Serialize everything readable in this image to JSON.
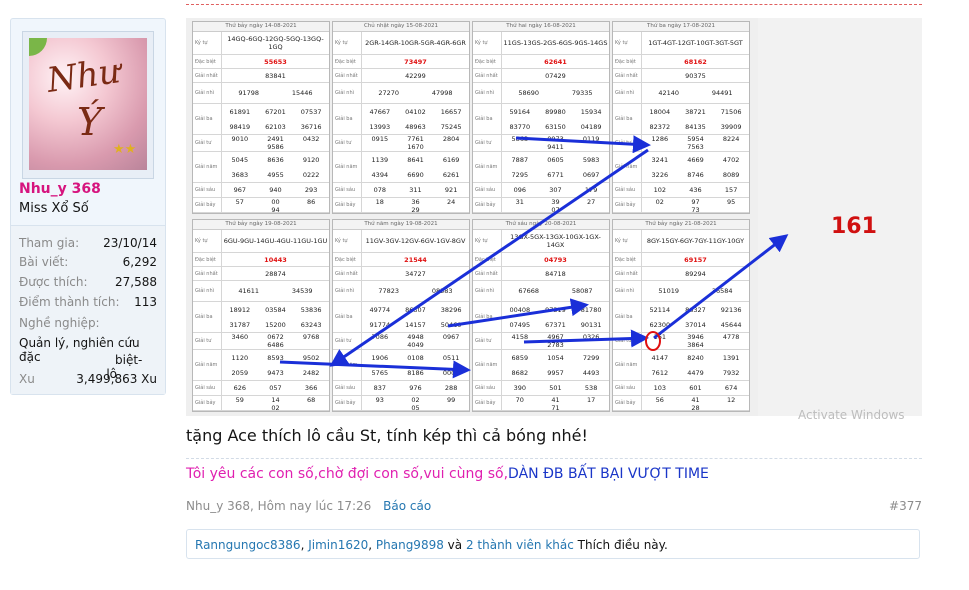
{
  "user": {
    "name": "Nhu_y 368",
    "title": "Miss Xổ Số",
    "avatar_text_1": "Như",
    "avatar_text_2": "Ý",
    "stats": [
      {
        "label": "Tham gia:",
        "value": "23/10/14"
      },
      {
        "label": "Bài viết:",
        "value": "6,292"
      },
      {
        "label": "Được thích:",
        "value": "27,588"
      },
      {
        "label": "Điểm thành tích:",
        "value": "113"
      },
      {
        "label": "Nghề nghiệp:",
        "value": ""
      },
      {
        "label": "Quản lý, nghiên cứu đặc",
        "value": ""
      },
      {
        "label": "biệt- lô",
        "value": ""
      },
      {
        "label": "Xu",
        "value": "3,499,863 Xu"
      }
    ]
  },
  "image": {
    "highlight_number": "161",
    "watermark": "Activate Windows",
    "row_labels": [
      "Ký tự",
      "Đặc biệt",
      "Giải nhất",
      "Giải nhì",
      "Giải ba",
      "Giải tư",
      "Giải năm",
      "Giải sáu",
      "Giải bảy"
    ],
    "tables": [
      {
        "date": "Thứ bảy ngày 14-08-2021",
        "kytu": "14GQ-6GQ-12GQ-5GQ-13GQ-1GQ",
        "db": "55653",
        "g1": "83841",
        "g2": [
          "91798",
          "15446"
        ],
        "g3": [
          "61891",
          "67201",
          "07537",
          "98419",
          "62103",
          "36716"
        ],
        "g4": [
          "9010",
          "2491",
          "0432",
          "9586"
        ],
        "g5": [
          "5045",
          "8636",
          "9120",
          "3683",
          "4955",
          "0222"
        ],
        "g6": [
          "967",
          "940",
          "293"
        ],
        "g7": [
          "57",
          "00",
          "86",
          "94"
        ]
      },
      {
        "date": "Chủ nhật ngày 15-08-2021",
        "kytu": "2GR-14GR-10GR-5GR-4GR-6GR",
        "db": "73497",
        "g1": "42299",
        "g2": [
          "27270",
          "47998"
        ],
        "g3": [
          "47667",
          "04102",
          "16657",
          "13993",
          "48963",
          "75245"
        ],
        "g4": [
          "0915",
          "7761",
          "2804",
          "1670"
        ],
        "g5": [
          "1139",
          "8641",
          "6169",
          "4394",
          "6690",
          "6261"
        ],
        "g6": [
          "078",
          "311",
          "921"
        ],
        "g7": [
          "18",
          "36",
          "24",
          "29"
        ]
      },
      {
        "date": "Thứ hai ngày 16-08-2021",
        "kytu": "11GS-13GS-2GS-6GS-9GS-14GS",
        "db": "62641",
        "g1": "07429",
        "g2": [
          "58690",
          "79335"
        ],
        "g3": [
          "59164",
          "89980",
          "15934",
          "83770",
          "63150",
          "04189"
        ],
        "g4": [
          "5863",
          "0973",
          "0119",
          "9411"
        ],
        "g5": [
          "7887",
          "0605",
          "5983",
          "7295",
          "6771",
          "0697"
        ],
        "g6": [
          "096",
          "307",
          "179"
        ],
        "g7": [
          "31",
          "39",
          "27",
          "07"
        ]
      },
      {
        "date": "Thứ ba ngày 17-08-2021",
        "kytu": "1GT-4GT-12GT-10GT-3GT-5GT",
        "db": "68162",
        "g1": "90375",
        "g2": [
          "42140",
          "94491"
        ],
        "g3": [
          "18004",
          "38721",
          "71506",
          "82372",
          "84135",
          "39909"
        ],
        "g4": [
          "1286",
          "5954",
          "8224",
          "7563"
        ],
        "g5": [
          "3241",
          "4669",
          "4702",
          "3226",
          "8746",
          "8089"
        ],
        "g6": [
          "102",
          "436",
          "157"
        ],
        "g7": [
          "02",
          "97",
          "95",
          "73"
        ]
      },
      {
        "date": "Thứ bảy ngày 19-08-2021",
        "kytu": "6GU-9GU-14GU-4GU-11GU-1GU",
        "db": "10443",
        "g1": "28874",
        "g2": [
          "41611",
          "34539"
        ],
        "g3": [
          "18912",
          "03584",
          "53836",
          "31787",
          "15200",
          "63243"
        ],
        "g4": [
          "3460",
          "0672",
          "9768",
          "6486"
        ],
        "g5": [
          "1120",
          "8593",
          "9502",
          "2059",
          "9473",
          "2482"
        ],
        "g6": [
          "626",
          "057",
          "366"
        ],
        "g7": [
          "59",
          "14",
          "68",
          "02"
        ]
      },
      {
        "date": "Thứ năm ngày 19-08-2021",
        "kytu": "11GV-3GV-12GV-6GV-1GV-8GV",
        "db": "21544",
        "g1": "34727",
        "g2": [
          "77823",
          "08383"
        ],
        "g3": [
          "49774",
          "86307",
          "38296",
          "91774",
          "14157",
          "50469"
        ],
        "g4": [
          "7086",
          "4948",
          "0967",
          "4049"
        ],
        "g5": [
          "1906",
          "0108",
          "0511",
          "5765",
          "8186",
          "0004"
        ],
        "g6": [
          "837",
          "976",
          "288"
        ],
        "g7": [
          "93",
          "02",
          "99",
          "05"
        ]
      },
      {
        "date": "Thứ sáu ngày 20-08-2021",
        "kytu": "13GX-5GX-13GX-10GX-1GX-14GX",
        "db": "04793",
        "g1": "84718",
        "g2": [
          "67668",
          "58087"
        ],
        "g3": [
          "00408",
          "97319",
          "81780",
          "07495",
          "67371",
          "90131"
        ],
        "g4": [
          "4158",
          "4967",
          "0326",
          "2783"
        ],
        "g5": [
          "6859",
          "1054",
          "7299",
          "8682",
          "9957",
          "4493"
        ],
        "g6": [
          "390",
          "501",
          "538"
        ],
        "g7": [
          "70",
          "41",
          "17",
          "71"
        ]
      },
      {
        "date": "Thứ bảy ngày 21-08-2021",
        "kytu": "8GY-15GY-6GY-7GY-11GY-10GY",
        "db": "69157",
        "g1": "89294",
        "g2": [
          "51019",
          "36584"
        ],
        "g3": [
          "52114",
          "86327",
          "92136",
          "62300",
          "37014",
          "45644"
        ],
        "g4": [
          "161",
          "3946",
          "4778",
          "3864"
        ],
        "g5": [
          "4147",
          "8240",
          "1391",
          "7612",
          "4479",
          "7932"
        ],
        "g6": [
          "103",
          "601",
          "674"
        ],
        "g7": [
          "56",
          "41",
          "12",
          "28"
        ]
      }
    ]
  },
  "post": {
    "text": "tặng Ace thích lô cầu St, tính kép thì cả bóng nhé!",
    "signature_pink": "Tôi yêu các con số,chờ đợi con số,vui cùng số,",
    "signature_blue": "DÀN ĐB BẤT BẠI VƯỢT TIME",
    "meta": "Nhu_y 368, Hôm nay lúc 17:26",
    "report": "Báo cáo",
    "number": "#377"
  },
  "likes": {
    "users": [
      "Ranngungoc8386",
      "Jimin1620",
      "Phang9898"
    ],
    "separator": ", ",
    "and": " và ",
    "others": "2 thành viên khác",
    "suffix": " Thích điều này."
  },
  "colors": {
    "username": "#d6147e",
    "link": "#2577b1",
    "arrow": "#1a2fd8",
    "special_prize": "#e01010"
  }
}
